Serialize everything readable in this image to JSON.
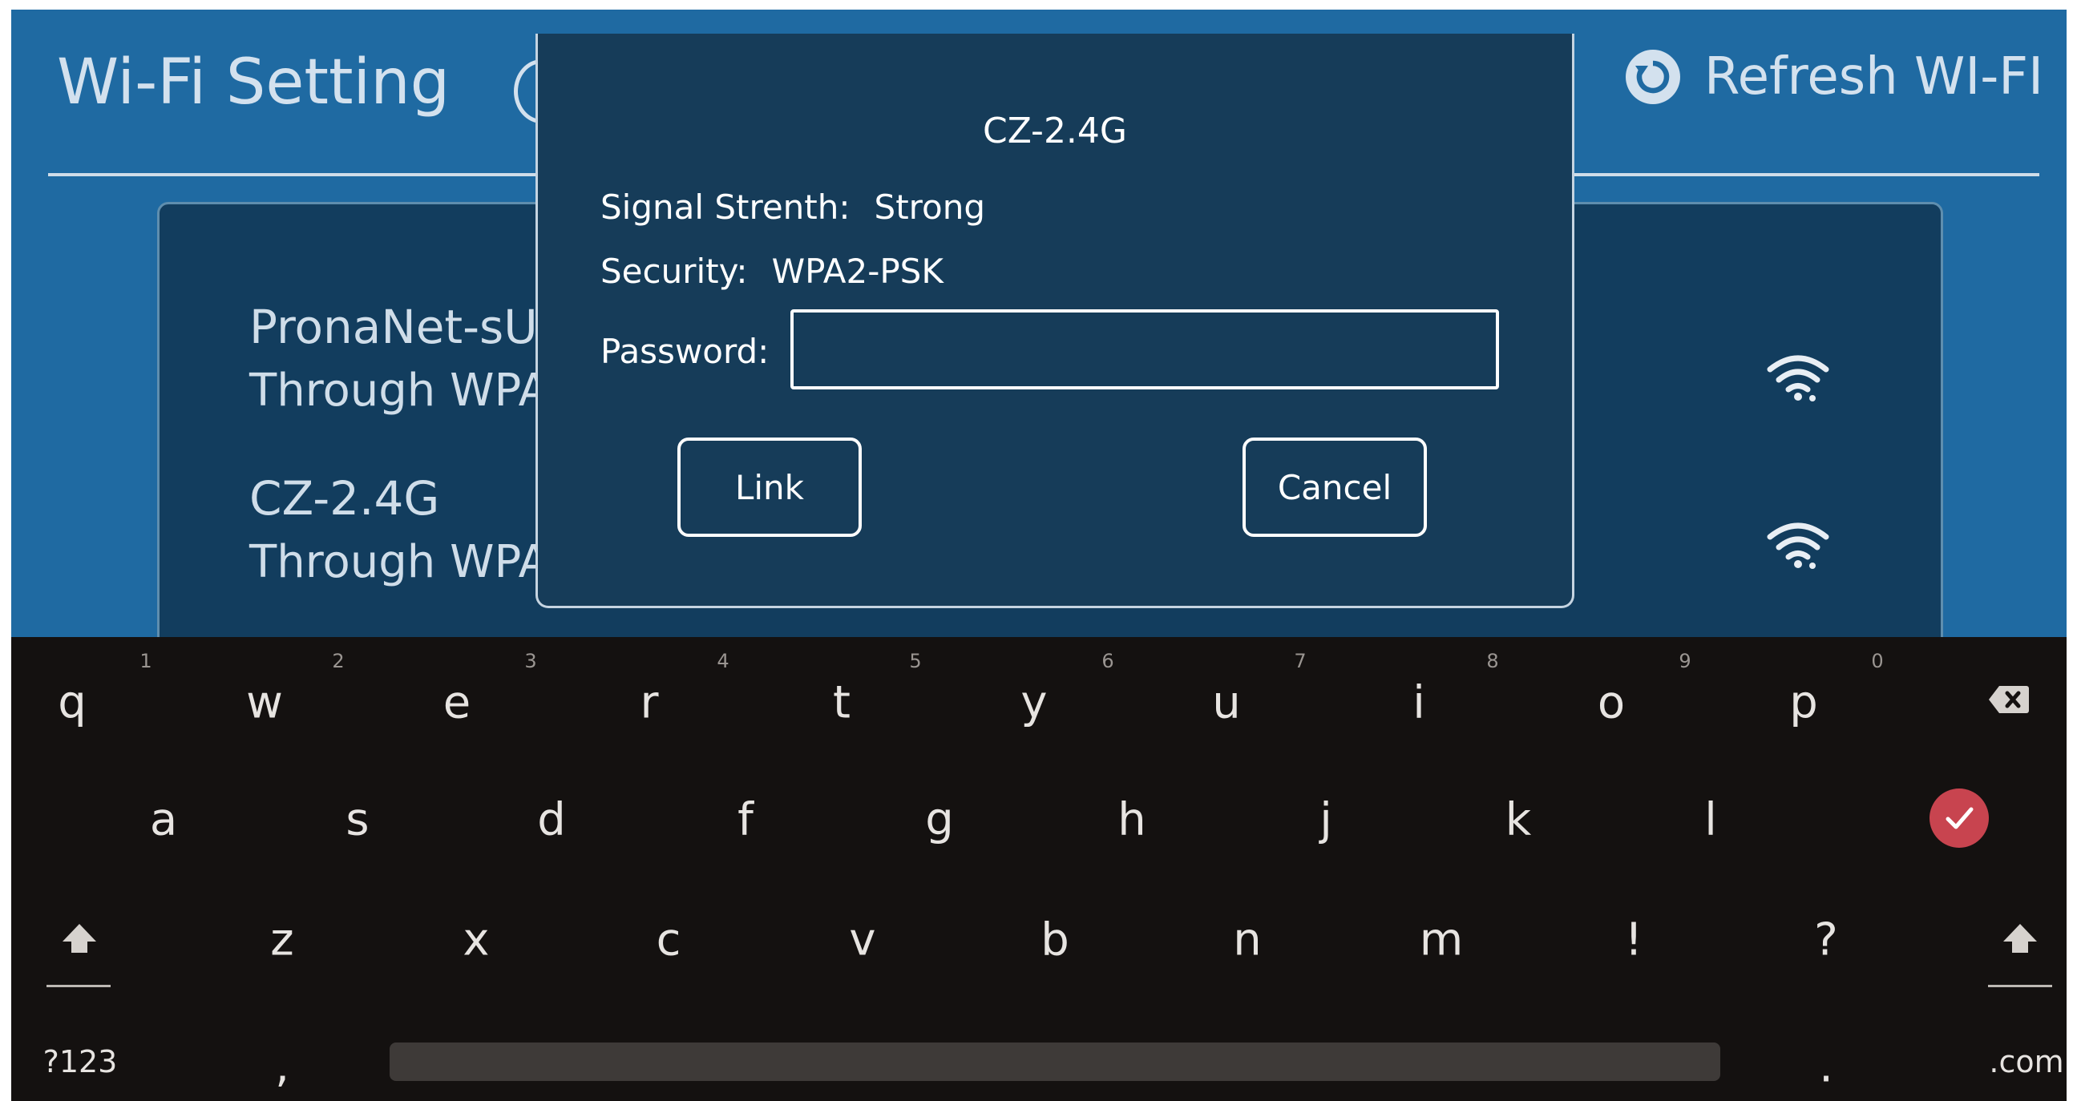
{
  "header": {
    "title": "Wi-Fi Setting",
    "refresh_label": "Refresh WI-FI"
  },
  "networks": [
    {
      "name": "PronaNet-sU",
      "security": "Through WPA"
    },
    {
      "name": "CZ-2.4G",
      "security": "Through WPA"
    }
  ],
  "dialog": {
    "title": "CZ-2.4G",
    "signal_label": "Signal Strenth:",
    "signal_value": "Strong",
    "security_label": "Security:",
    "security_value": "WPA2-PSK",
    "password_label": "Password:",
    "password_value": "",
    "link_label": "Link",
    "cancel_label": "Cancel"
  },
  "keyboard": {
    "row1": [
      "q",
      "w",
      "e",
      "r",
      "t",
      "y",
      "u",
      "i",
      "o",
      "p"
    ],
    "row1_hints": [
      "1",
      "2",
      "3",
      "4",
      "5",
      "6",
      "7",
      "8",
      "9",
      "0"
    ],
    "row2": [
      "a",
      "s",
      "d",
      "f",
      "g",
      "h",
      "j",
      "k",
      "l"
    ],
    "row3": [
      "z",
      "x",
      "c",
      "v",
      "b",
      "n",
      "m",
      "!",
      "?"
    ],
    "numbers_label": "?123",
    "comma_label": ",",
    "period_label": ".",
    "dotcom_label": ".com",
    "enter_color": "#c8444f"
  },
  "colors": {
    "screen_bg": "#1f6aa2",
    "panel_bg": "#123d5e",
    "dialog_bg": "#163c59",
    "keyboard_bg": "#141110"
  },
  "icons": {
    "refresh": "refresh-icon",
    "wifi": "wifi-icon",
    "backspace": "backspace-icon",
    "enter": "check-icon",
    "shift": "shift-icon"
  }
}
